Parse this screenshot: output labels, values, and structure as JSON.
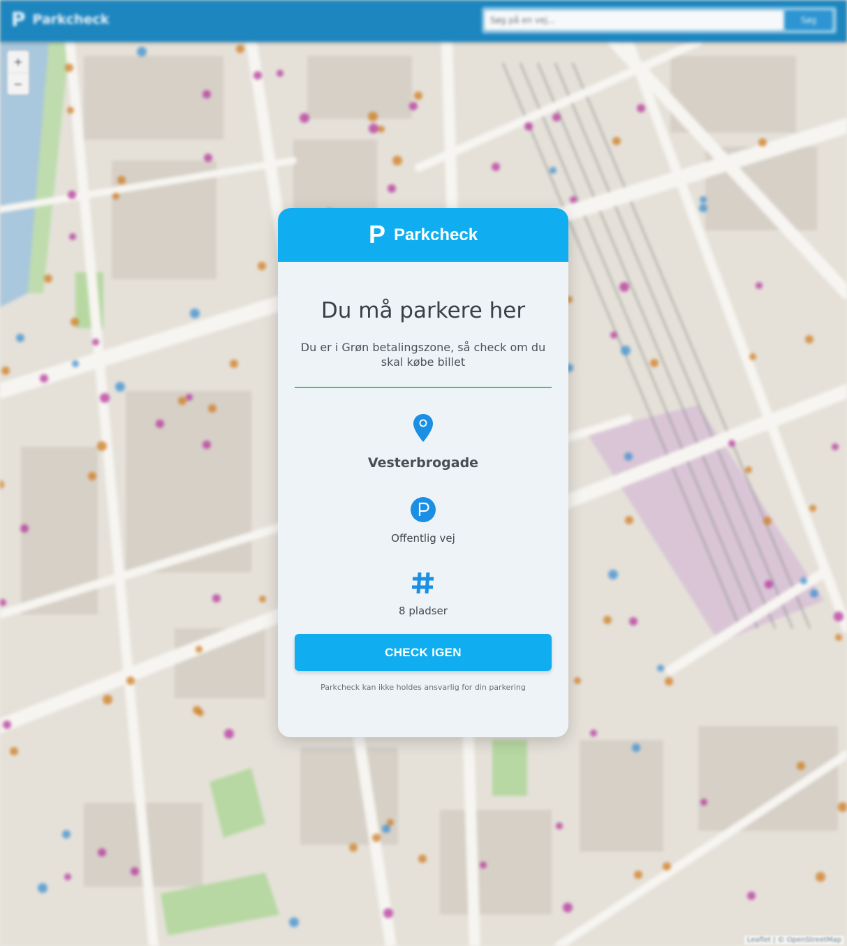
{
  "app": {
    "name": "Parkcheck",
    "logo_letter": "P"
  },
  "topbar": {
    "brand": "Parkcheck",
    "search_placeholder": "Søg på en vej...",
    "search_button": "Søg"
  },
  "map": {
    "zoom_in": "+",
    "zoom_out": "−",
    "attribution": "Leaflet | © OpenStreetMap"
  },
  "modal": {
    "header_title": "Parkcheck",
    "headline": "Du må parkere her",
    "subtext": "Du er i Grøn betalingszone, så check om du skal købe billet",
    "street_name": "Vesterbrogade",
    "road_type": "Offentlig vej",
    "spaces": "8 pladser",
    "check_button": "CHECK IGEN",
    "disclaimer": "Parkcheck kan ikke holdes ansvarlig for din parkering"
  },
  "colors": {
    "brand_blue": "#10aef0",
    "topbar_blue": "#1d86bf",
    "zone_green": "#3fcc5c",
    "icon_blue": "#1a8fe3"
  },
  "icons": [
    "map-pin-icon",
    "parking-icon",
    "hash-icon"
  ]
}
